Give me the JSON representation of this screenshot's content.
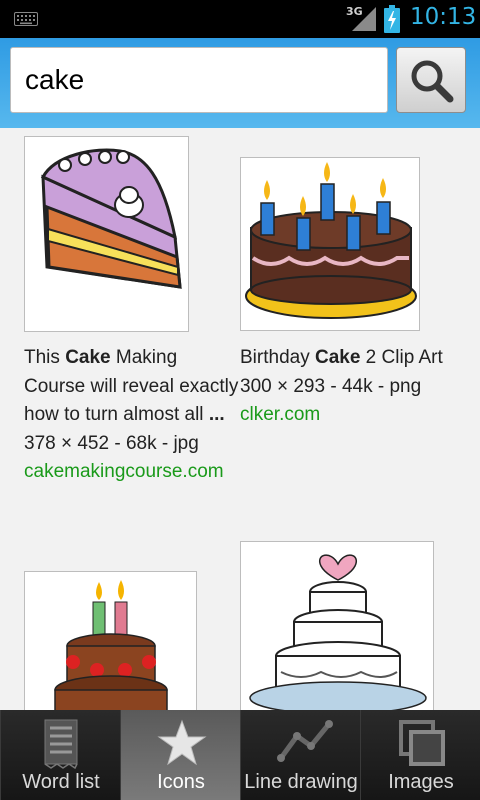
{
  "status_bar": {
    "network": "3G",
    "time": "10:13",
    "icons": [
      "keyboard-icon",
      "signal-icon",
      "battery-charging-icon"
    ]
  },
  "search": {
    "query": "cake",
    "button_icon": "search-icon"
  },
  "results": [
    {
      "title_before": "This ",
      "title_bold": "Cake",
      "title_after": " Making Course will reveal exactly how to turn almost all ",
      "title_ellipsis": "...",
      "meta": "378 × 452 - 68k - jpg",
      "domain": "cakemakingcourse.com"
    },
    {
      "title_before": "Birthday ",
      "title_bold": "Cake",
      "title_after": " 2 Clip Art",
      "meta": "300 × 293 - 44k - png",
      "domain": "clker.com"
    },
    {
      "image": "birthday-cake-with-candles"
    },
    {
      "image": "wedding-cake-with-heart"
    }
  ],
  "tabs": [
    {
      "label": "Word list",
      "icon": "word-list-icon",
      "active": false
    },
    {
      "label": "Icons",
      "icon": "star-icon",
      "active": true
    },
    {
      "label": "Line drawing",
      "icon": "line-drawing-icon",
      "active": false
    },
    {
      "label": "Images",
      "icon": "images-icon",
      "active": false
    }
  ],
  "colors": {
    "header_blue": "#2f9be3",
    "clock_blue": "#33b5e5",
    "domain_green": "#1a9a1a"
  }
}
